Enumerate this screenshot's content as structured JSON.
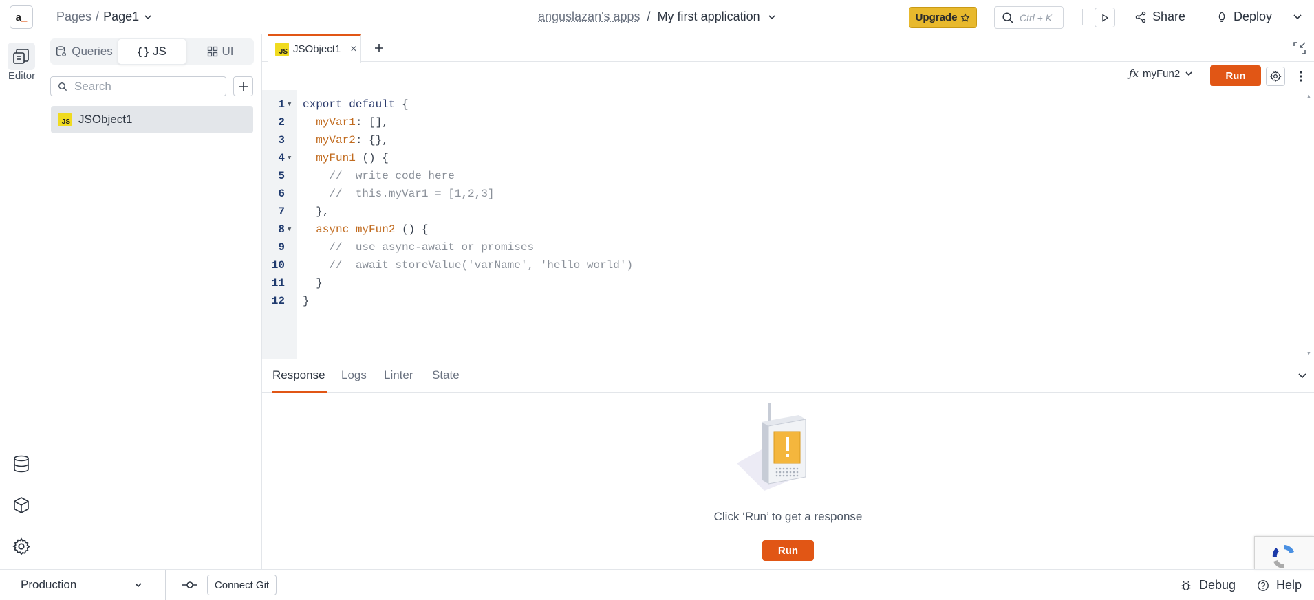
{
  "topbar": {
    "logo_text": "a",
    "pages_label": "Pages",
    "separator": "/",
    "current_page": "Page1",
    "workspace": "anguslazan's apps",
    "app_separator": "/",
    "app_name": "My first application",
    "upgrade_label": "Upgrade",
    "search_shortcut": "Ctrl + K",
    "share_label": "Share",
    "deploy_label": "Deploy"
  },
  "rail": {
    "editor_label": "Editor",
    "icons": [
      "editor-icon",
      "datasource-icon",
      "package-icon",
      "settings-icon"
    ]
  },
  "explorer": {
    "tabs": [
      {
        "label": "Queries",
        "icon": "queries-icon",
        "active": false
      },
      {
        "label": "JS",
        "icon": "braces-icon",
        "active": true
      },
      {
        "label": "UI",
        "icon": "widgets-icon",
        "active": false
      }
    ],
    "search_placeholder": "Search",
    "items": [
      {
        "badge": "JS",
        "label": "JSObject1",
        "selected": true
      }
    ]
  },
  "editor": {
    "tab_label": "JSObject1",
    "tab_badge": "JS",
    "tab_close": "×",
    "add_tab": "+",
    "function_label": "myFun2",
    "run_label": "Run",
    "lines": [
      {
        "n": "1",
        "fold": true
      },
      {
        "n": "2",
        "fold": false
      },
      {
        "n": "3",
        "fold": false
      },
      {
        "n": "4",
        "fold": true
      },
      {
        "n": "5",
        "fold": false
      },
      {
        "n": "6",
        "fold": false
      },
      {
        "n": "7",
        "fold": false
      },
      {
        "n": "8",
        "fold": true
      },
      {
        "n": "9",
        "fold": false
      },
      {
        "n": "10",
        "fold": false
      },
      {
        "n": "11",
        "fold": false
      },
      {
        "n": "12",
        "fold": false
      }
    ],
    "code": {
      "l1_kw": "export default",
      "l1_rest": " {",
      "l2_prop": "myVar1",
      "l2_rest": ": [],",
      "l3_prop": "myVar2",
      "l3_rest": ": {},",
      "l4_prop": "myFun1",
      "l4_rest": " () {",
      "l5": "//  write code here",
      "l6": "//  this.myVar1 = [1,2,3]",
      "l7": "},",
      "l8_kw": "async",
      "l8_prop": "myFun2",
      "l8_rest": " () {",
      "l9": "//  use async-await or promises",
      "l10": "//  await storeValue('varName', 'hello world')",
      "l11": "}",
      "l12": "}"
    }
  },
  "response": {
    "tabs": [
      "Response",
      "Logs",
      "Linter",
      "State"
    ],
    "active_tab": "Response",
    "message": "Click ‘Run’ to get a response",
    "run_label": "Run"
  },
  "statusbar": {
    "environment": "Production",
    "connect_git": "Connect Git",
    "debug_label": "Debug",
    "help_label": "Help"
  },
  "colors": {
    "accent": "#e15615",
    "upgrade": "#e8b92d",
    "js_badge": "#f0db20",
    "selected_bg": "#e3e6ea"
  }
}
